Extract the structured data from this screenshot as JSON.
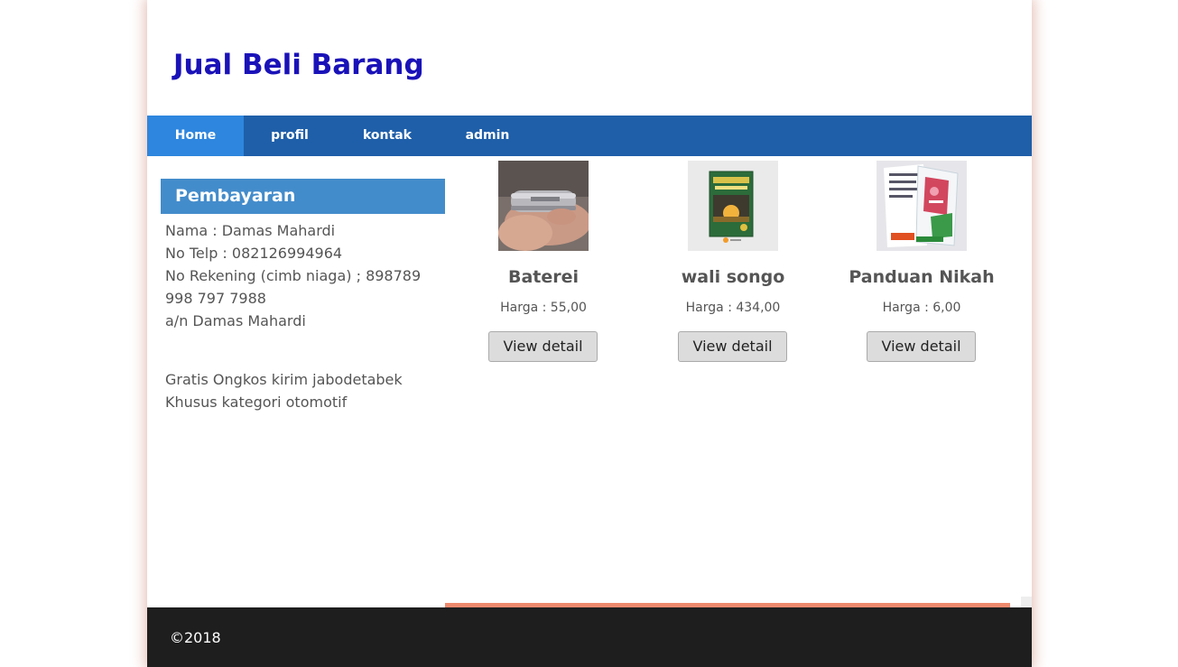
{
  "site": {
    "title": "Jual Beli Barang"
  },
  "nav": {
    "items": [
      {
        "label": "Home",
        "active": true
      },
      {
        "label": "profil"
      },
      {
        "label": "kontak"
      },
      {
        "label": "admin"
      }
    ]
  },
  "sidebar": {
    "heading": "Pembayaran",
    "lines": [
      "Nama : Damas Mahardi",
      "No Telp : 082126994964",
      "No Rekening (cimb niaga) ; 898789",
      "998 797 7988",
      "a/n Damas Mahardi"
    ],
    "notes": [
      "Gratis Ongkos kirim jabodetabek",
      "Khusus kategori otomotif"
    ]
  },
  "products": [
    {
      "name": "Baterei",
      "price": "Harga : 55,00",
      "button": "View detail",
      "image": "battery-photo"
    },
    {
      "name": "wali songo",
      "price": "Harga : 434,00",
      "button": "View detail",
      "image": "book-cover-photo"
    },
    {
      "name": "Panduan Nikah",
      "price": "Harga : 6,00",
      "button": "View detail",
      "image": "book-cover-photo"
    }
  ],
  "footer": {
    "copyright": "©2018"
  },
  "colors": {
    "title": "#1a12b8",
    "nav": "#1f5fa9",
    "nav_active": "#2e86de",
    "sidebar_head": "#438ccb",
    "accent": "#ee8a6e",
    "footer": "#1e1e1e"
  }
}
